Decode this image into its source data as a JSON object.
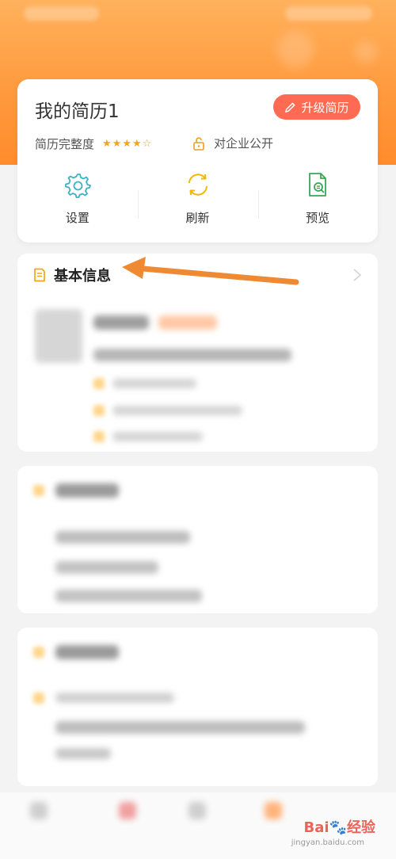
{
  "resume": {
    "title": "我的简历1",
    "upgrade_label": "升级简历",
    "completeness_label": "简历完整度",
    "stars_filled": 4,
    "stars_total": 5,
    "public_label": "对企业公开"
  },
  "actions": [
    {
      "label": "设置",
      "icon": "gear-icon"
    },
    {
      "label": "刷新",
      "icon": "refresh-icon"
    },
    {
      "label": "预览",
      "icon": "preview-document-icon"
    }
  ],
  "basic_info": {
    "title": "基本信息"
  },
  "colors": {
    "header_orange": "#ff9a3e",
    "upgrade_button": "#ff6b52",
    "icon_teal": "#3bb3c3",
    "icon_yellow": "#f2b705",
    "icon_green": "#3aa655",
    "arrow_orange": "#f08a32"
  },
  "watermark": {
    "text": "Bai🐾经验",
    "sub": "jingyan.baidu.com"
  }
}
